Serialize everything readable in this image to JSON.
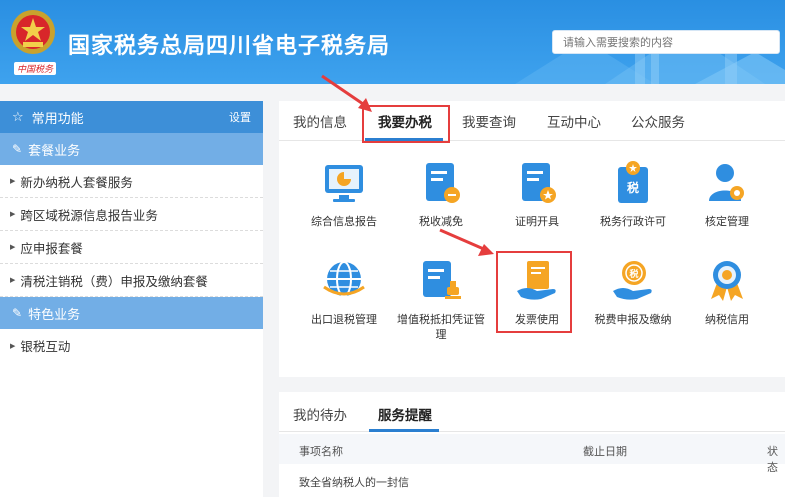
{
  "header": {
    "title": "国家税务总局四川省电子税务局",
    "emblem_caption": "中国税务",
    "search_placeholder": "请输入需要搜索的内容"
  },
  "sidebar": {
    "common_label": "常用功能",
    "settings_label": "设置",
    "sections": [
      {
        "label": "套餐业务",
        "items": [
          "新办纳税人套餐服务",
          "跨区域税源信息报告业务",
          "应申报套餐",
          "清税注销税（费）申报及缴纳套餐"
        ]
      },
      {
        "label": "特色业务",
        "items": [
          "银税互动"
        ]
      }
    ]
  },
  "main": {
    "tabs": [
      "我的信息",
      "我要办税",
      "我要查询",
      "互动中心",
      "公众服务"
    ],
    "active_tab": "我要办税",
    "items": [
      {
        "label": "综合信息报告",
        "icon": "monitor-chart-icon"
      },
      {
        "label": "税收减免",
        "icon": "doc-minus-icon"
      },
      {
        "label": "证明开具",
        "icon": "doc-star-icon"
      },
      {
        "label": "税务行政许可",
        "icon": "tax-badge-icon"
      },
      {
        "label": "核定管理",
        "icon": "person-gear-icon"
      },
      {
        "label": "出口退税管理",
        "icon": "globe-icon"
      },
      {
        "label": "增值税抵扣凭证管理",
        "icon": "doc-stamp-icon"
      },
      {
        "label": "发票使用",
        "icon": "hand-invoice-icon"
      },
      {
        "label": "税费申报及缴纳",
        "icon": "hand-coin-icon"
      },
      {
        "label": "纳税信用",
        "icon": "medal-icon"
      }
    ]
  },
  "bottom": {
    "tabs": [
      "我的待办",
      "服务提醒"
    ],
    "active_tab": "服务提醒",
    "columns": [
      "事项名称",
      "截止日期",
      "状态"
    ],
    "rows": [
      [
        "致全省纳税人的一封信",
        "",
        ""
      ]
    ]
  },
  "colors": {
    "accent": "#2b7fd0",
    "highlight": "#e53d3d",
    "header_bg": "#2f93e4"
  }
}
